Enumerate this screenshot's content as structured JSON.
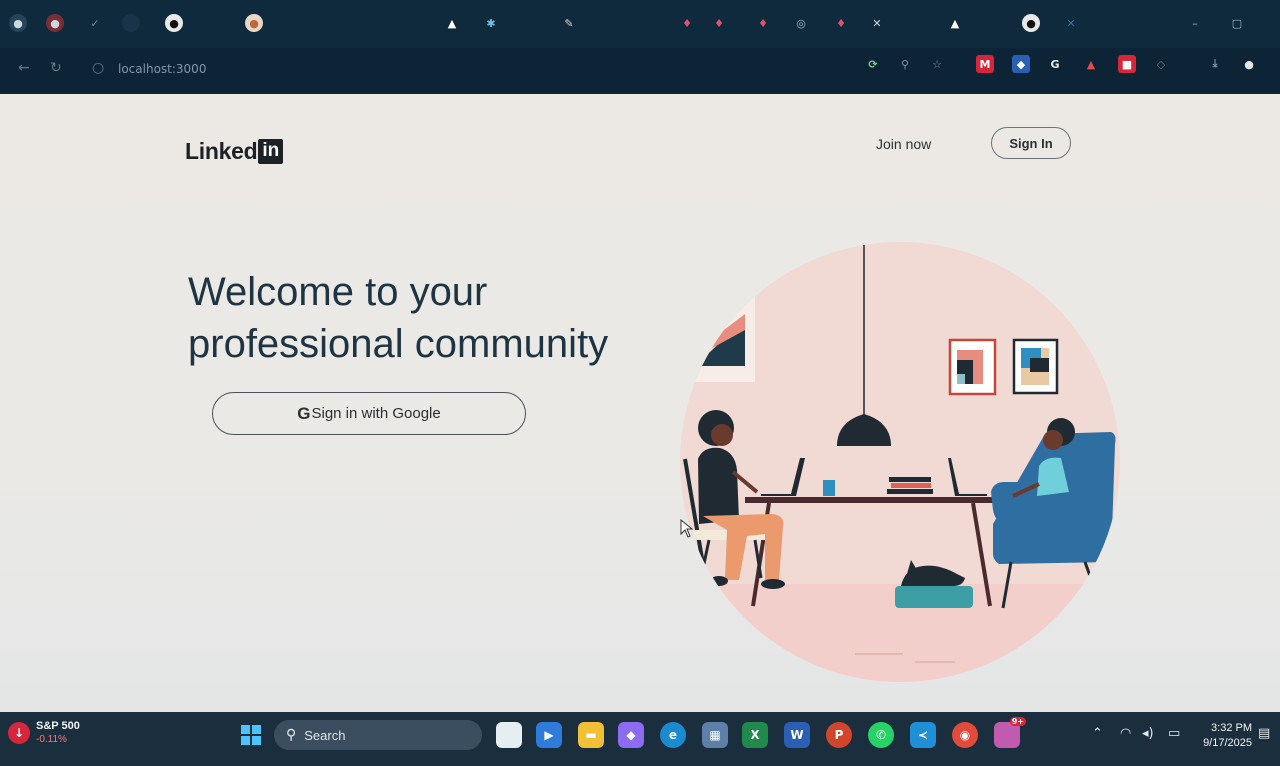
{
  "browser": {
    "url": "localhost:3000",
    "accent": "#0f2a3d"
  },
  "header": {
    "logo_text": "Linked",
    "logo_box": "in",
    "join_label": "Join now",
    "signin_label": "Sign In"
  },
  "hero": {
    "headline_line1": "Welcome to your",
    "headline_line2": "professional community",
    "google_glyph": "G",
    "google_label": "Sign in with Google"
  },
  "taskbar": {
    "stock_name": "S&P 500",
    "stock_change": "-0.11%",
    "search_label": "Search",
    "time": "3:32 PM",
    "date": "9/17/2025",
    "notification_badge": "9+"
  },
  "icons": [
    "github-icon",
    "search-icon",
    "star-icon",
    "download-icon",
    "windows-start-icon",
    "wifi-icon",
    "volume-icon",
    "battery-icon",
    "notification-icon"
  ]
}
